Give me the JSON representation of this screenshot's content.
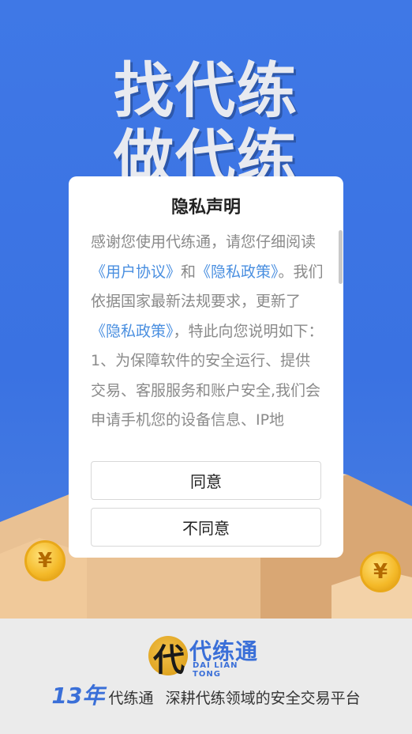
{
  "splash": {
    "headline_line1": "找代练",
    "headline_line2": "做代练",
    "coin_symbol": "¥"
  },
  "dialog": {
    "title": "隐私声明",
    "body": [
      {
        "text": "感谢您使用代练通，请您仔细阅读",
        "link": false
      },
      {
        "text": "《用户协议》",
        "link": true
      },
      {
        "text": "和",
        "link": false
      },
      {
        "text": "《隐私政策》",
        "link": true
      },
      {
        "text": "。我们依据国家最新法规要求，更新了",
        "link": false
      },
      {
        "text": "《隐私政策》",
        "link": true
      },
      {
        "text": "，特此向您说明如下：",
        "link": false
      },
      {
        "text": "1、为保障软件的安全运行、提供交易、客服服务和账户安全,我们会申请手机您的设备信息、IP地",
        "link": false
      }
    ],
    "agree_label": "同意",
    "disagree_label": "不同意"
  },
  "footer": {
    "logo_cn": "代练通",
    "logo_en": "DAI LIAN TONG",
    "years": "13年",
    "brand": "代练通",
    "slogan": "深耕代练领域的安全交易平台"
  },
  "colors": {
    "background_blue": "#3b73e3",
    "link_blue": "#4a8fe0",
    "brand_blue": "#3a6fd8"
  }
}
